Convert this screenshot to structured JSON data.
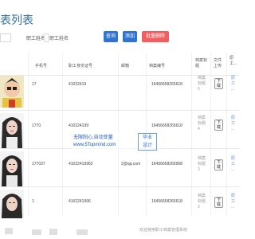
{
  "page": {
    "title": "表列表"
  },
  "filters": {
    "field1_label": "",
    "field2_label": "职工姓名",
    "field3_label": "职工姓名"
  },
  "toolbar": {
    "search": "查询",
    "add": "添加",
    "batch_delete": "批量删除"
  },
  "table": {
    "headers": {
      "phone": "手机号",
      "idcard": "职工身份证号",
      "email": "邮箱",
      "archive_no": "档案编号",
      "archive_title": "档案标题",
      "file_upload": "文件上传",
      "name_short": "原工..."
    },
    "rows": [
      {
        "phone": "17",
        "idcard": "41022419",
        "email": "",
        "archive_no": "16456658265618",
        "title": [
          "档案",
          "标题",
          "5"
        ],
        "download": [
          "下",
          "载"
        ],
        "name": [
          "原",
          "工",
          "..."
        ]
      },
      {
        "phone": "1770",
        "idcard": "410224199",
        "email": "",
        "archive_no": "16456658265618",
        "title": [
          "档案",
          "标题",
          "4"
        ],
        "download": [
          "下",
          "载"
        ],
        "name": [
          "原",
          "工",
          "..."
        ]
      },
      {
        "phone": "177037",
        "idcard": "41022419962",
        "email": "2@qq.com",
        "archive_no": "16456658265968",
        "title": [
          "档案",
          "标题",
          "3"
        ],
        "download": [
          "下",
          "载"
        ],
        "name": [
          "原",
          "工",
          "..."
        ]
      },
      {
        "phone": "1",
        "idcard": "4102241996",
        "email": "",
        "archive_no": "16456658265618",
        "title": [
          "档案",
          "标题",
          "2"
        ],
        "download": [
          "下",
          "载"
        ],
        "name": [
          "原",
          "工",
          "..."
        ]
      }
    ]
  },
  "watermark": {
    "line1": "无限阳心,自动变量",
    "line2": "www.5Topmind.com",
    "badge_line1": "毕业",
    "badge_line2": "设计"
  },
  "footer": {
    "text": "欢迎使用职工档案管理系统"
  }
}
